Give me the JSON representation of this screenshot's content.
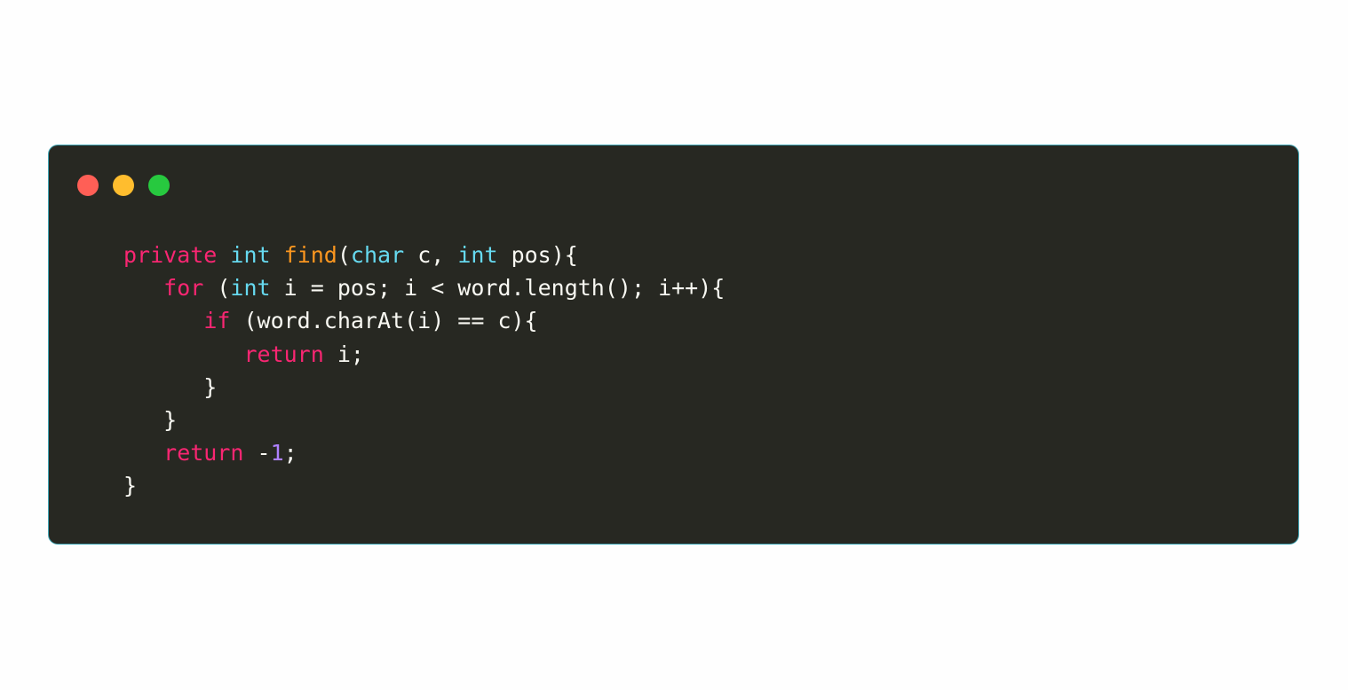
{
  "window": {
    "background": "#272822",
    "border_color": "#3fa5b4",
    "traffic_lights": [
      {
        "name": "close",
        "color": "#ff5f56"
      },
      {
        "name": "minimize",
        "color": "#ffbd2e"
      },
      {
        "name": "maximize",
        "color": "#27c93f"
      }
    ]
  },
  "code": {
    "language": "java",
    "colors": {
      "keyword": "#f92672",
      "type": "#66d9ef",
      "function": "#fd971f",
      "number": "#ae81ff",
      "plain": "#f8f8f2"
    },
    "lines": [
      [
        {
          "t": "kw",
          "v": "private"
        },
        {
          "t": "plain",
          "v": " "
        },
        {
          "t": "type",
          "v": "int"
        },
        {
          "t": "plain",
          "v": " "
        },
        {
          "t": "fn",
          "v": "find"
        },
        {
          "t": "plain",
          "v": "("
        },
        {
          "t": "type",
          "v": "char"
        },
        {
          "t": "plain",
          "v": " c, "
        },
        {
          "t": "type",
          "v": "int"
        },
        {
          "t": "plain",
          "v": " pos){"
        }
      ],
      [
        {
          "t": "plain",
          "v": "   "
        },
        {
          "t": "kw",
          "v": "for"
        },
        {
          "t": "plain",
          "v": " ("
        },
        {
          "t": "type",
          "v": "int"
        },
        {
          "t": "plain",
          "v": " i = pos; i < word.length(); i++){"
        }
      ],
      [
        {
          "t": "plain",
          "v": "      "
        },
        {
          "t": "kw",
          "v": "if"
        },
        {
          "t": "plain",
          "v": " (word.charAt(i) == c){"
        }
      ],
      [
        {
          "t": "plain",
          "v": "         "
        },
        {
          "t": "kw",
          "v": "return"
        },
        {
          "t": "plain",
          "v": " i;"
        }
      ],
      [
        {
          "t": "plain",
          "v": "      }"
        }
      ],
      [
        {
          "t": "plain",
          "v": "   }"
        }
      ],
      [
        {
          "t": "plain",
          "v": "   "
        },
        {
          "t": "kw",
          "v": "return"
        },
        {
          "t": "plain",
          "v": " -"
        },
        {
          "t": "num",
          "v": "1"
        },
        {
          "t": "plain",
          "v": ";"
        }
      ],
      [
        {
          "t": "plain",
          "v": "}"
        }
      ]
    ]
  }
}
